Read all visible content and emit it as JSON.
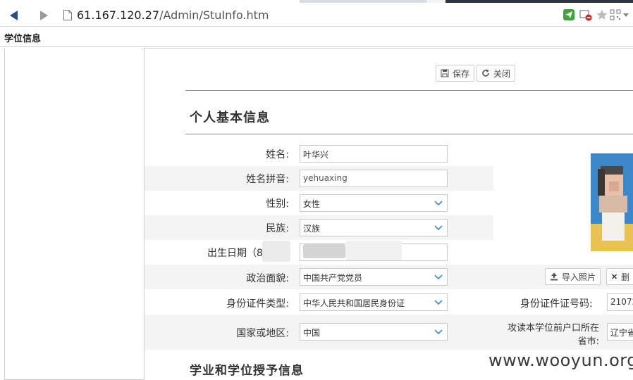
{
  "browser": {
    "url_host": "61.167.120.27",
    "url_path": "/Admin/StuInfo.htm"
  },
  "app": {
    "title": "学位信息"
  },
  "toolbar": {
    "save_label": "保存",
    "close_label": "关闭"
  },
  "section1": {
    "title": "个人基本信息"
  },
  "section2": {
    "title": "学业和学位授予信息"
  },
  "fields": {
    "name": {
      "label": "姓名:",
      "value": "叶华兴"
    },
    "pinyin": {
      "label": "姓名拼音:",
      "value": "yehuaxing"
    },
    "gender": {
      "label": "性别:",
      "value": "女性"
    },
    "ethnicity": {
      "label": "民族:",
      "value": "汉族"
    },
    "birthdate": {
      "label": "出生日期（8",
      "value": ""
    },
    "politics": {
      "label": "政治面貌:",
      "value": "中国共产党党员"
    },
    "id_type": {
      "label": "身份证件类型:",
      "value": "中华人民共和国居民身份证"
    },
    "country": {
      "label": "国家或地区:",
      "value": "中国"
    },
    "id_number": {
      "label": "身份证件证号码:",
      "value": "21072"
    },
    "hukou": {
      "label_line1": "攻读本学位前户口所在",
      "label_line2": "省市:",
      "value": "辽宁省"
    }
  },
  "photo": {
    "import_label": "导入照片",
    "delete_label": "删"
  },
  "watermark": "www.wooyun.org"
}
